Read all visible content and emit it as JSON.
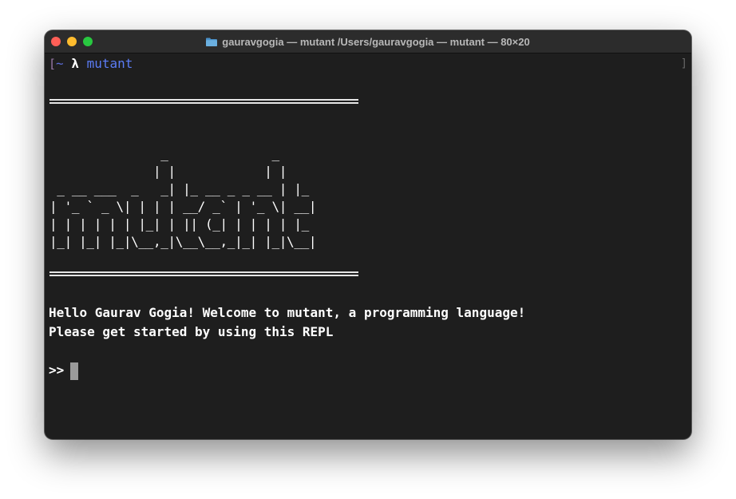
{
  "window": {
    "title": "gauravgogia — mutant /Users/gauravgogia — mutant — 80×20",
    "icon": "folder-icon"
  },
  "shell": {
    "open_bracket": "[",
    "cwd": "~",
    "prompt_symbol": "λ",
    "command": "mutant",
    "close_bracket": "]"
  },
  "banner": {
    "ascii_art": "               _              _   \n              | |            | |  \n _ __ ___  _   _| |_ __ _ _ __ | |_ \n| '_ ` _ \\| | | | __/ _` | '_ \\| __|\n| | | | | | |_| | || (_| | | | | |_ \n|_| |_| |_|\\__,_|\\__\\__,_|_| |_|\\__|"
  },
  "messages": {
    "welcome": "Hello Gaurav Gogia! Welcome to mutant, a programming language!",
    "instruction": "Please get started by using this REPL"
  },
  "repl": {
    "prompt": ">>"
  },
  "colors": {
    "window_bg": "#1e1e1e",
    "titlebar_bg": "#2c2c2c",
    "command_blue": "#5b7cf5",
    "close": "#ff5f57",
    "minimize": "#febc2e",
    "maximize": "#28c840"
  }
}
